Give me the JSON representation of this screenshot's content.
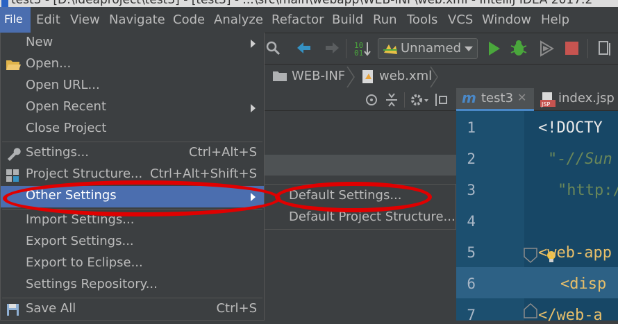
{
  "window": {
    "title": "test3 - [D:\\ideaproject\\test3] - [test3] - ...\\src\\main\\webapp\\WEB-INF\\web.xml - IntelliJ IDEA 2017.2"
  },
  "menubar": {
    "items": [
      "File",
      "Edit",
      "View",
      "Navigate",
      "Code",
      "Analyze",
      "Refactor",
      "Build",
      "Run",
      "Tools",
      "VCS",
      "Window",
      "Help"
    ]
  },
  "toolbar": {
    "run_config_label": "Unnamed"
  },
  "breadcrumb": {
    "items": [
      "WEB-INF",
      "web.xml"
    ]
  },
  "editor_tabs": [
    "test3",
    "index.jsp"
  ],
  "editor": {
    "line_numbers": [
      "1",
      "2",
      "3",
      "4",
      "5",
      "6",
      "7"
    ],
    "lines": [
      "<!DOCTY",
      "\"-//Sun",
      "\"http:/",
      "",
      "<web-app",
      "<disp",
      "</web-a"
    ]
  },
  "file_menu": {
    "items": [
      {
        "label": "New",
        "shortcut": "",
        "submenu": true,
        "icon": ""
      },
      {
        "label": "Open...",
        "shortcut": "",
        "submenu": false,
        "icon": "folder-icon"
      },
      {
        "label": "Open URL...",
        "shortcut": "",
        "submenu": false,
        "icon": ""
      },
      {
        "label": "Open Recent",
        "shortcut": "",
        "submenu": true,
        "icon": ""
      },
      {
        "label": "Close Project",
        "shortcut": "",
        "submenu": false,
        "icon": ""
      },
      {
        "label": "Settings...",
        "shortcut": "Ctrl+Alt+S",
        "submenu": false,
        "icon": "wrench-icon"
      },
      {
        "label": "Project Structure...",
        "shortcut": "Ctrl+Alt+Shift+S",
        "submenu": false,
        "icon": "project-structure-icon"
      },
      {
        "label": "Other Settings",
        "shortcut": "",
        "submenu": true,
        "icon": ""
      },
      {
        "label": "Import Settings...",
        "shortcut": "",
        "submenu": false,
        "icon": ""
      },
      {
        "label": "Export Settings...",
        "shortcut": "",
        "submenu": false,
        "icon": ""
      },
      {
        "label": "Export to Eclipse...",
        "shortcut": "",
        "submenu": false,
        "icon": ""
      },
      {
        "label": "Settings Repository...",
        "shortcut": "",
        "submenu": false,
        "icon": ""
      },
      {
        "label": "Save All",
        "shortcut": "Ctrl+S",
        "submenu": false,
        "icon": "save-icon"
      }
    ],
    "selected": "Other Settings"
  },
  "submenu": {
    "items": [
      "Default Settings...",
      "Default Project Structure..."
    ]
  },
  "colors": {
    "selection": "#4b6eaf",
    "annotation": "#e00000",
    "run_green": "#4aa73c",
    "stop_red": "#c75450",
    "back_blue": "#3592c4"
  }
}
